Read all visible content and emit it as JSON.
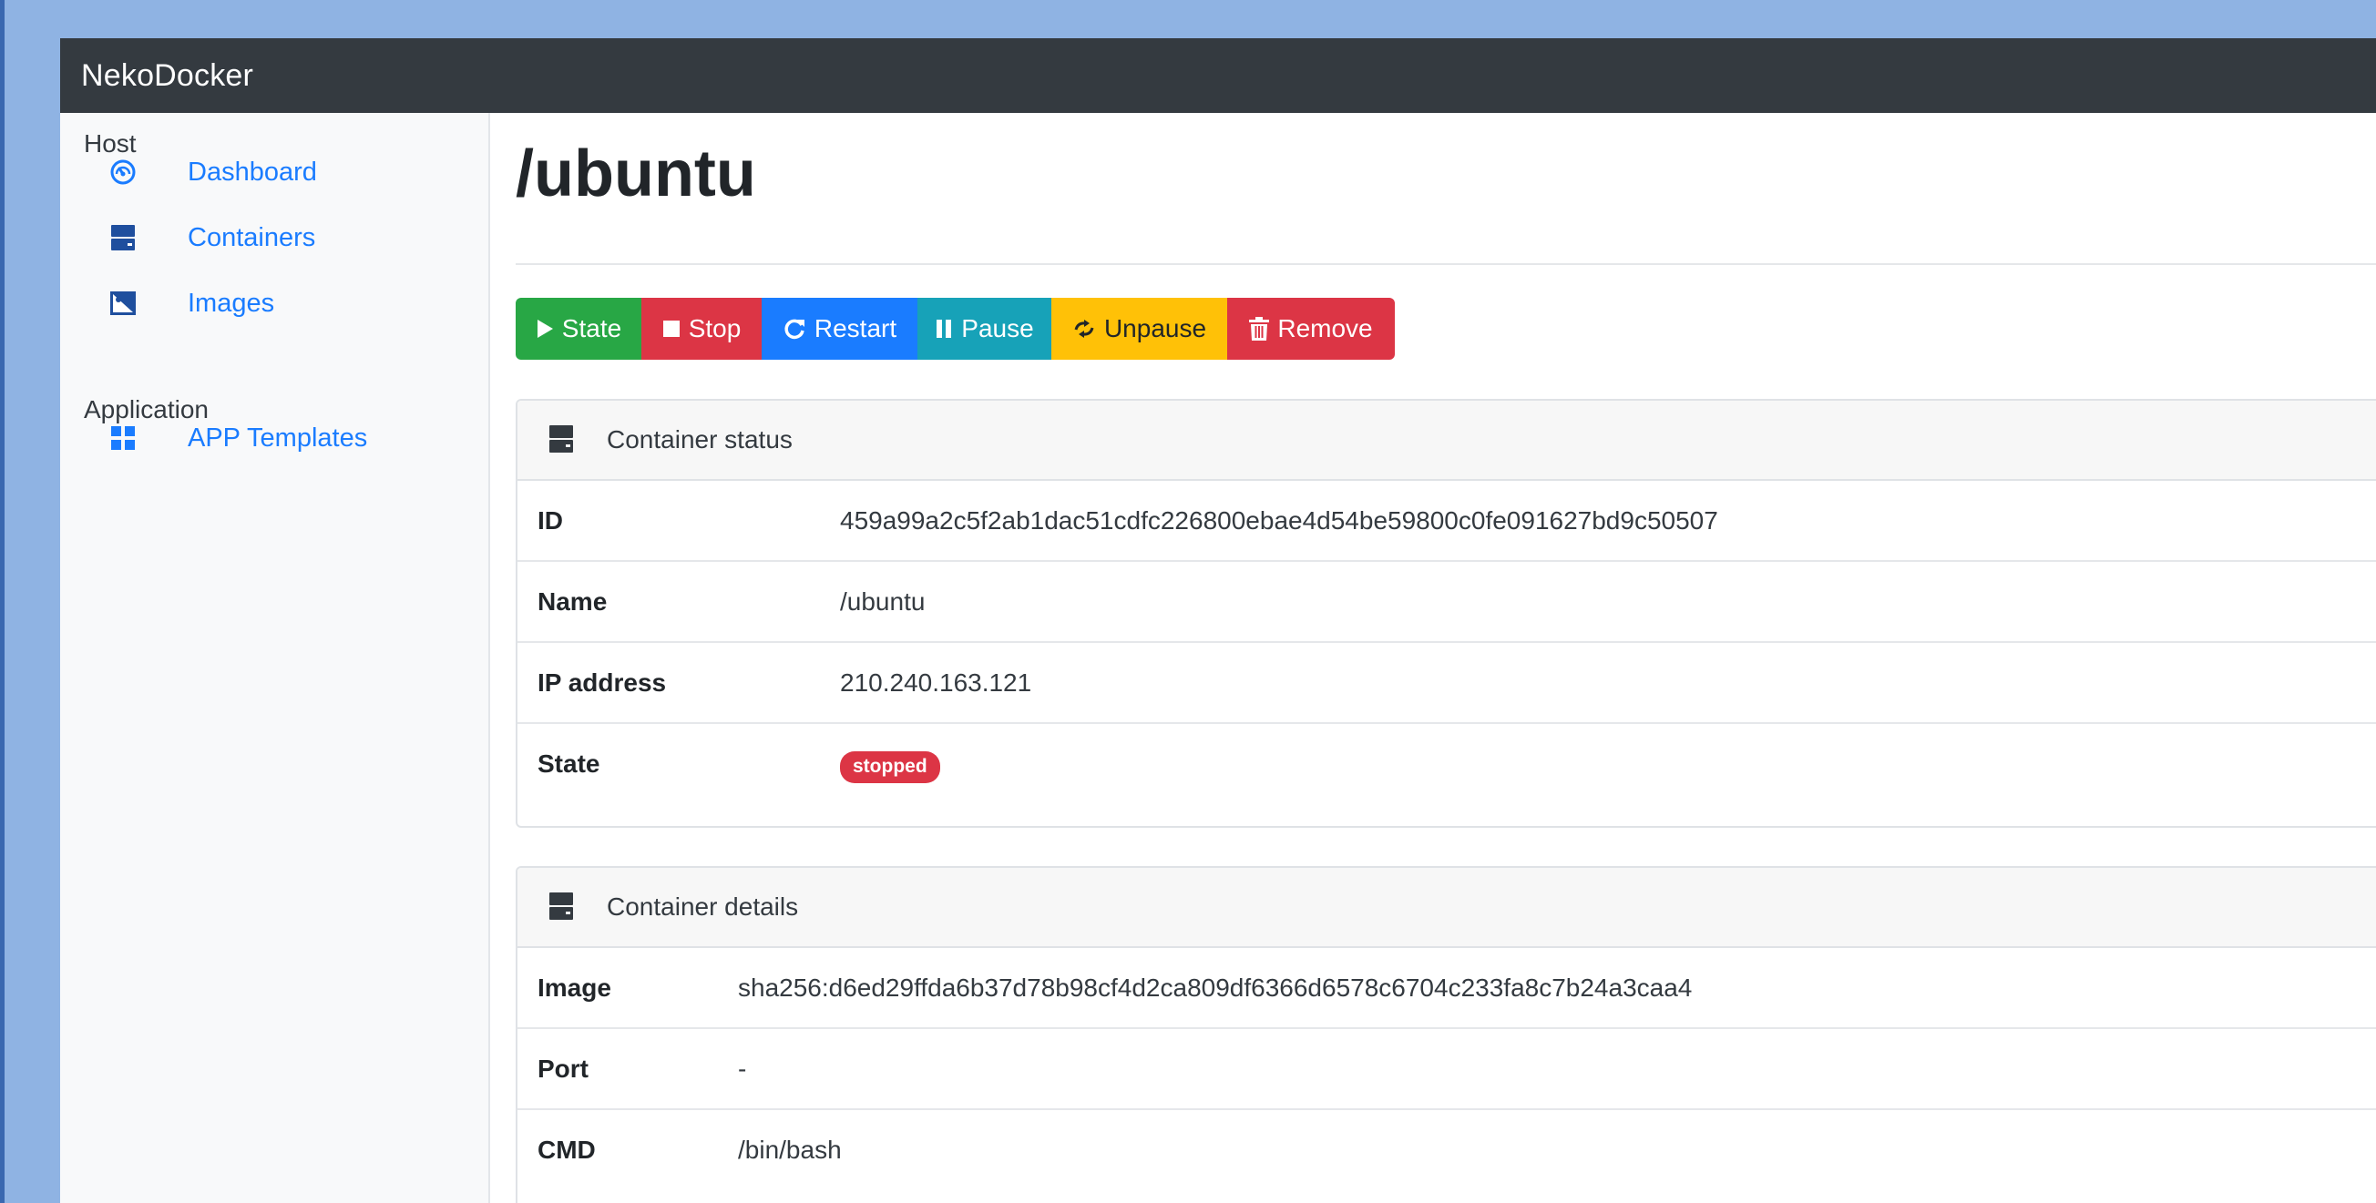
{
  "app": {
    "brand": "NekoDocker"
  },
  "sidebar": {
    "sections": [
      {
        "heading": "Host",
        "items": [
          {
            "label": "Dashboard",
            "icon": "dashboard-gauge-icon"
          },
          {
            "label": "Containers",
            "icon": "server-icon"
          },
          {
            "label": "Images",
            "icon": "image-icon"
          }
        ]
      },
      {
        "heading": "Application",
        "items": [
          {
            "label": "APP Templates",
            "icon": "grid-icon"
          }
        ]
      }
    ]
  },
  "page": {
    "title": "/ubuntu"
  },
  "actions": {
    "state": "State",
    "stop": "Stop",
    "restart": "Restart",
    "pause": "Pause",
    "unpause": "Unpause",
    "remove": "Remove"
  },
  "status_card": {
    "title": "Container status",
    "rows": [
      {
        "key": "ID",
        "value": "459a99a2c5f2ab1dac51cdfc226800ebae4d54be59800c0fe091627bd9c50507"
      },
      {
        "key": "Name",
        "value": "/ubuntu"
      },
      {
        "key": "IP address",
        "value": "210.240.163.121"
      },
      {
        "key": "State",
        "value": "stopped"
      }
    ]
  },
  "details_card": {
    "title": "Container details",
    "rows": [
      {
        "key": "Image",
        "value": "sha256:d6ed29ffda6b37d78b98cf4d2ca809df6366d6578c6704c233fa8c7b24a3caa4"
      },
      {
        "key": "Port",
        "value": "-"
      },
      {
        "key": "CMD",
        "value": "/bin/bash"
      }
    ]
  },
  "colors": {
    "navbar": "#343a40",
    "link": "#1a7cff",
    "success": "#28a745",
    "danger": "#dc3545",
    "info": "#17a2b8",
    "warning": "#ffc107",
    "desktop": "#8fb3e3"
  }
}
